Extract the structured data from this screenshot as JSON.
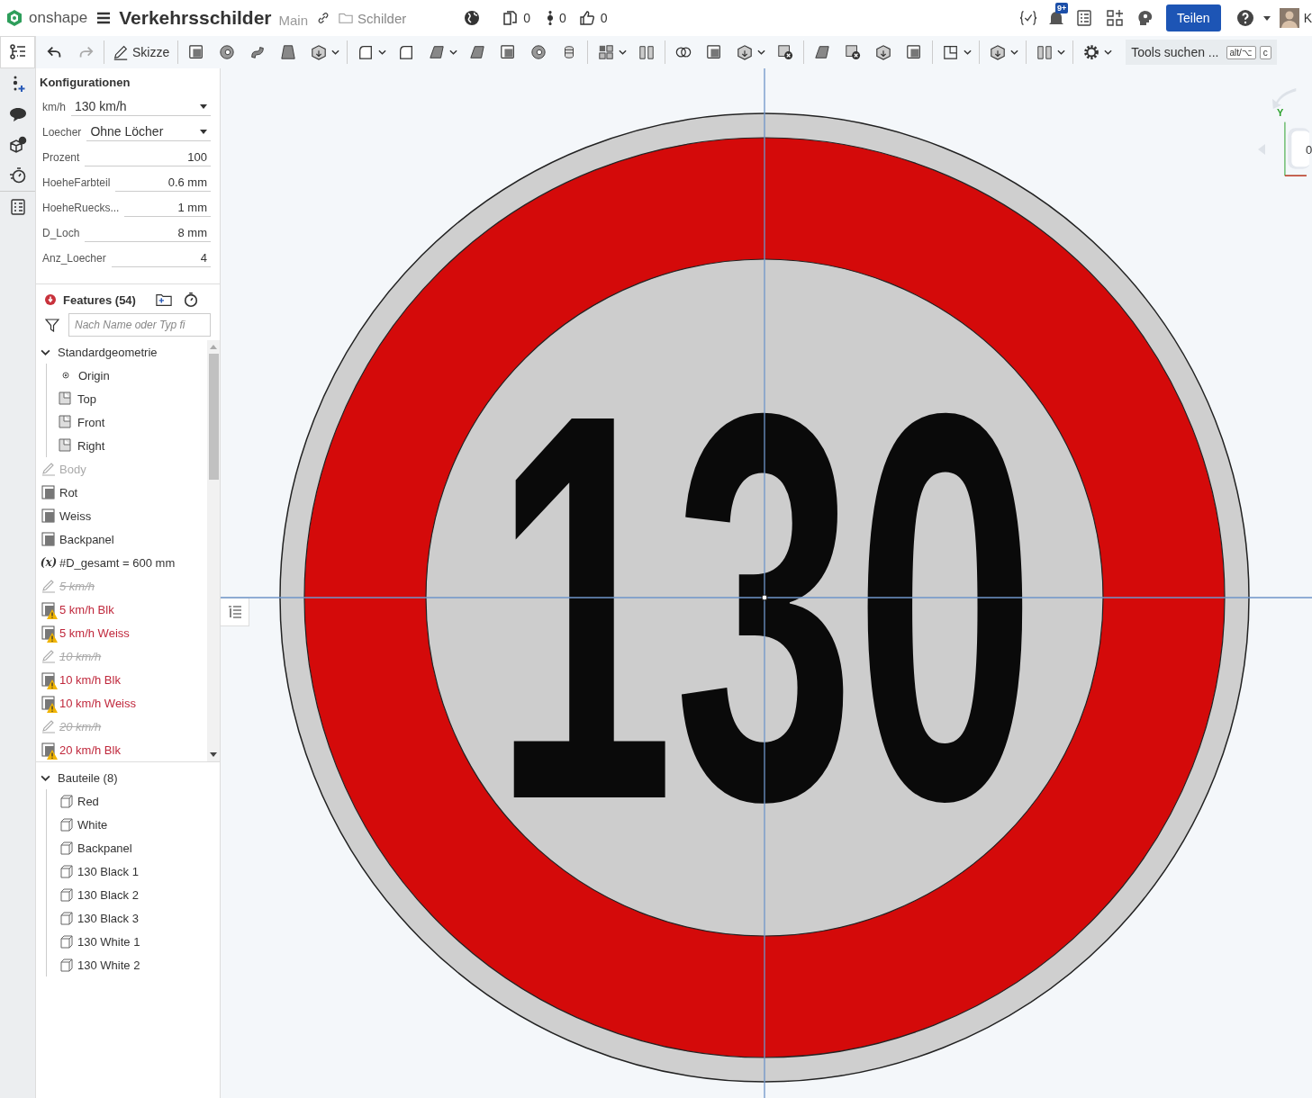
{
  "header": {
    "brand": "onshape",
    "document_title": "Verkehrsschilder",
    "branch": "Main",
    "folder": "Schilder",
    "counters": [
      "0",
      "0",
      "0"
    ],
    "notifications_badge": "9+",
    "share_button": "Teilen",
    "user_initial": "K"
  },
  "toolbar": {
    "sketch_button": "Skizze",
    "tool_search": {
      "label": "Tools suchen ...",
      "keys": [
        "alt/⌥",
        "c"
      ]
    }
  },
  "rail": [
    {
      "selected": true
    },
    {
      "selected": false
    },
    {
      "selected": false
    },
    {
      "selected": false
    },
    {
      "selected": false
    },
    {
      "selected": false
    }
  ],
  "configurations": {
    "title": "Konfigurationen",
    "params": [
      {
        "kind": "select",
        "label": "km/h",
        "value": "130 km/h"
      },
      {
        "kind": "select",
        "label": "Loecher",
        "value": "Ohne Löcher"
      },
      {
        "kind": "number",
        "label": "Prozent",
        "value": "100"
      },
      {
        "kind": "number",
        "label": "HoeheFarbteil",
        "value": "0.6 mm"
      },
      {
        "kind": "number",
        "label": "HoeheRuecks...",
        "value": "1 mm"
      },
      {
        "kind": "number",
        "label": "D_Loch",
        "value": "8 mm"
      },
      {
        "kind": "number",
        "label": "Anz_Loecher",
        "value": "4"
      }
    ]
  },
  "features": {
    "title": "Features (54)",
    "has_error": true,
    "filter_placeholder": "Nach Name oder Typ fi",
    "items": [
      {
        "kind": "group",
        "label": "Standardgeometrie",
        "expanded": true,
        "children": [
          {
            "kind": "origin",
            "label": "Origin"
          },
          {
            "kind": "plane",
            "label": "Top"
          },
          {
            "kind": "plane",
            "label": "Front"
          },
          {
            "kind": "plane",
            "label": "Right"
          }
        ]
      },
      {
        "kind": "sketch",
        "label": "Body",
        "greyed": true,
        "suppressed": false,
        "warning": false
      },
      {
        "kind": "extrude",
        "label": "Rot",
        "greyed": false,
        "suppressed": false,
        "warning": false
      },
      {
        "kind": "extrude",
        "label": "Weiss",
        "greyed": false,
        "suppressed": false,
        "warning": false
      },
      {
        "kind": "extrude",
        "label": "Backpanel",
        "greyed": false,
        "suppressed": false,
        "warning": false
      },
      {
        "kind": "variable",
        "symbol": "(x)",
        "label": "#D_gesamt = 600 mm",
        "greyed": false,
        "suppressed": false,
        "warning": false
      },
      {
        "kind": "sketch",
        "label": "5 km/h",
        "greyed": true,
        "suppressed": true,
        "warning": false
      },
      {
        "kind": "extrude",
        "label": "5 km/h Blk",
        "greyed": false,
        "suppressed": false,
        "warning": true
      },
      {
        "kind": "extrude",
        "label": "5 km/h Weiss",
        "greyed": false,
        "suppressed": false,
        "warning": true
      },
      {
        "kind": "sketch",
        "label": "10 km/h",
        "greyed": true,
        "suppressed": true,
        "warning": false
      },
      {
        "kind": "extrude",
        "label": "10 km/h Blk",
        "greyed": false,
        "suppressed": false,
        "warning": true
      },
      {
        "kind": "extrude",
        "label": "10 km/h Weiss",
        "greyed": false,
        "suppressed": false,
        "warning": true
      },
      {
        "kind": "sketch",
        "label": "20 km/h",
        "greyed": true,
        "suppressed": true,
        "warning": false
      },
      {
        "kind": "extrude",
        "label": "20 km/h Blk",
        "greyed": false,
        "suppressed": false,
        "warning": true
      }
    ]
  },
  "parts": {
    "title": "Bauteile (8)",
    "expanded": true,
    "items": [
      "Red",
      "White",
      "Backpanel",
      "130 Black 1",
      "130 Black 2",
      "130 Black 3",
      "130 White 1",
      "130 White 2"
    ]
  },
  "viewport": {
    "sign_number": "130",
    "view_cube_label": "0",
    "axis_label": "Y"
  }
}
